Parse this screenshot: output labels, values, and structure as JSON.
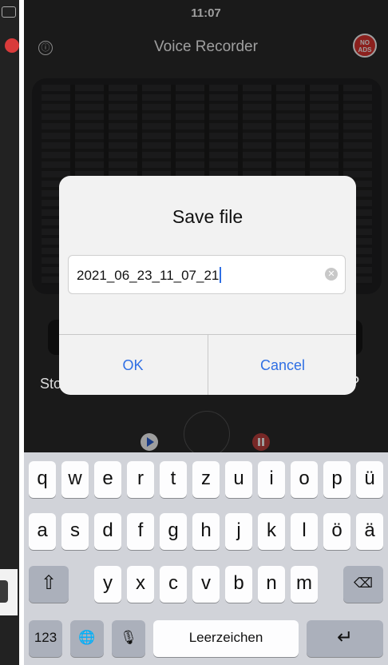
{
  "status": {
    "time": "11:07"
  },
  "header": {
    "title": "Voice Recorder",
    "info_icon": "ⓘ",
    "noads_label": "NO\nADS"
  },
  "dialog": {
    "title": "Save file",
    "filename": "2021_06_23_11_07_21",
    "ok_label": "OK",
    "cancel_label": "Cancel"
  },
  "background": {
    "sto": "Sto",
    "question": "?"
  },
  "keyboard": {
    "row1": [
      "q",
      "w",
      "e",
      "r",
      "t",
      "z",
      "u",
      "i",
      "o",
      "p",
      "ü"
    ],
    "row2": [
      "a",
      "s",
      "d",
      "f",
      "g",
      "h",
      "j",
      "k",
      "l",
      "ö",
      "ä"
    ],
    "row3": [
      "y",
      "x",
      "c",
      "v",
      "b",
      "n",
      "m"
    ],
    "numbers_label": "123",
    "space_label": "Leerzeichen",
    "shift_icon": "⇧",
    "delete_icon": "⌫",
    "globe_icon": "🌐",
    "mic_icon": "🎙",
    "return_icon": "↵"
  },
  "colors": {
    "accent": "#2f6fe4",
    "record_red": "#e0342f"
  }
}
